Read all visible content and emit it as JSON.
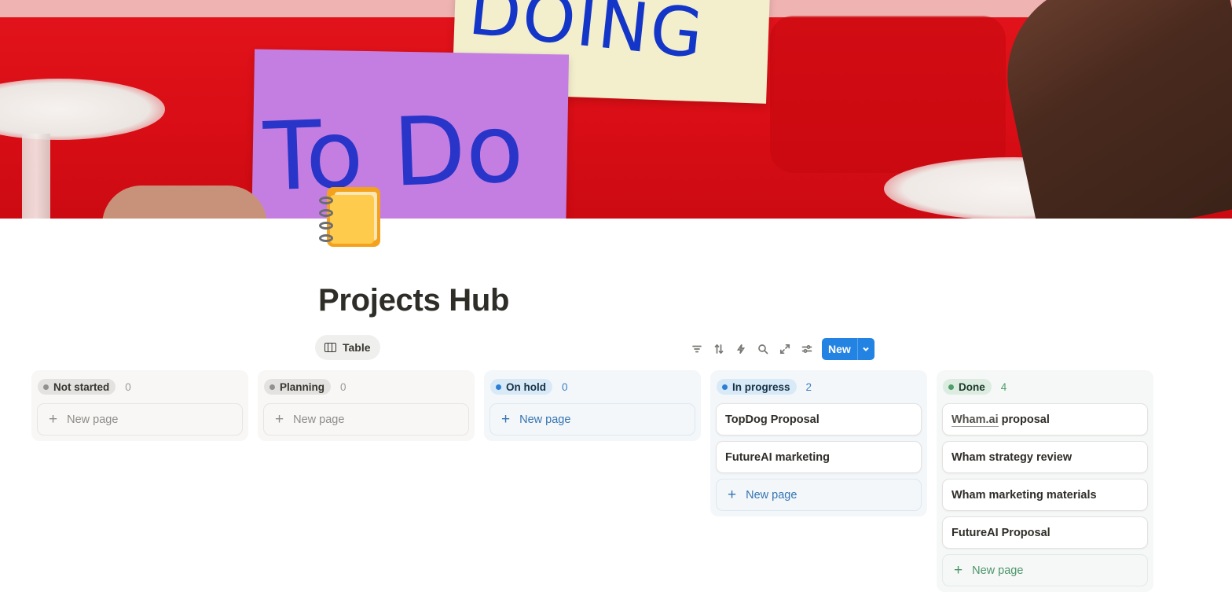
{
  "cover": {
    "note_yellow_text": "DOING",
    "note_purple_text": "To Do"
  },
  "page": {
    "icon": "notebook-icon",
    "title": "Projects Hub"
  },
  "view": {
    "tab_label": "Table",
    "tab_icon": "table-icon"
  },
  "toolbar": {
    "icons": [
      "filter-icon",
      "sort-icon",
      "automation-icon",
      "search-icon",
      "expand-icon",
      "settings-icon"
    ],
    "new_label": "New",
    "accent": "#2383e2"
  },
  "board": {
    "new_page_label": "New page",
    "columns": [
      {
        "status": "Not started",
        "count": "0",
        "color": "gray",
        "cards": []
      },
      {
        "status": "Planning",
        "count": "0",
        "color": "gray",
        "cards": []
      },
      {
        "status": "On hold",
        "count": "0",
        "color": "blue",
        "cards": []
      },
      {
        "status": "In progress",
        "count": "2",
        "color": "blue",
        "cards": [
          "TopDog Proposal",
          "FutureAI marketing"
        ]
      },
      {
        "status": "Done",
        "count": "4",
        "color": "green",
        "cards": [
          "Wham.ai proposal",
          "Wham strategy review",
          "Wham marketing materials",
          "FutureAI Proposal"
        ]
      }
    ]
  }
}
